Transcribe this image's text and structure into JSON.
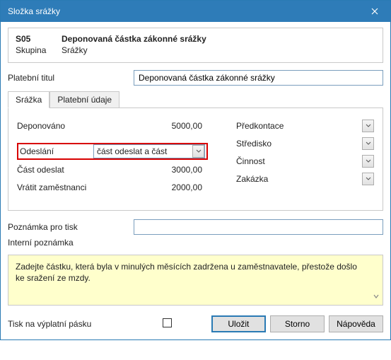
{
  "window_title": "Složka srážky",
  "header": {
    "code_label": "S05",
    "code_value": "Deponovaná částka zákonné srážky",
    "group_label": "Skupina",
    "group_value": "Srážky"
  },
  "payment_title": {
    "label": "Platební titul",
    "value": "Deponovaná částka zákonné srážky"
  },
  "tabs": {
    "t0": "Srážka",
    "t1": "Platební údaje"
  },
  "left": {
    "deponovano_label": "Deponováno",
    "deponovano_value": "5000,00",
    "odeslani_label": "Odeslání",
    "odeslani_value": "část odeslat a část",
    "cast_odeslat_label": "Část odeslat",
    "cast_odeslat_value": "3000,00",
    "vratit_label": "Vrátit zaměstnanci",
    "vratit_value": "2000,00"
  },
  "right": {
    "predkontace": "Předkontace",
    "stredisko": "Středisko",
    "cinnost": "Činnost",
    "zakazka": "Zakázka"
  },
  "notes": {
    "print_label": "Poznámka pro tisk",
    "print_value": "",
    "internal_label": "Interní poznámka"
  },
  "helpbox": "Zadejte částku, která byla v minulých měsících zadržena u zaměstnavatele, přestože došlo ke sražení ze mzdy.",
  "footer": {
    "tisk_label": "Tisk na výplatní pásku",
    "save": "Uložit",
    "cancel": "Storno",
    "help": "Nápověda"
  }
}
